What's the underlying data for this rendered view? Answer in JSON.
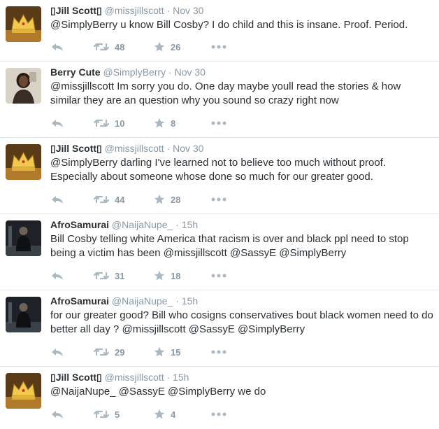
{
  "colors": {
    "name": "#292f33",
    "meta": "#8899a6",
    "action_icon": "#aab8c2",
    "divider": "#e1e8ed"
  },
  "tweets": [
    {
      "fullname": "▯Jill Scott▯",
      "username": "@missjillscott",
      "separator": "·",
      "time": "Nov 30",
      "text": "@SimplyBerry u know Bill Cosby? I do child and this is insane. Proof. Period.",
      "retweets": "48",
      "likes": "26",
      "avatar_icon": "crown-avatar"
    },
    {
      "fullname": "Berry Cute",
      "username": "@SimplyBerry",
      "separator": "·",
      "time": "Nov 30",
      "text": "@missjillscott Im sorry you do. One day maybe youll read the stories & how similar they are an question why you sound so crazy right now",
      "retweets": "10",
      "likes": "8",
      "avatar_icon": "photo-avatar"
    },
    {
      "fullname": "▯Jill Scott▯",
      "username": "@missjillscott",
      "separator": "·",
      "time": "Nov 30",
      "text": "@SimplyBerry darling I've learned not to believe too much without proof. Especially about someone whose done so much for our greater good.",
      "retweets": "44",
      "likes": "28",
      "avatar_icon": "crown-avatar"
    },
    {
      "fullname": "AfroSamurai",
      "username": "@NaijaNupe_",
      "separator": "·",
      "time": "15h",
      "text": "Bill Cosby telling white America that racism is over and black ppl need to stop being a victim has been @missjillscott @SassyE @SimplyBerry",
      "retweets": "31",
      "likes": "18",
      "avatar_icon": "dark-figure-avatar"
    },
    {
      "fullname": "AfroSamurai",
      "username": "@NaijaNupe_",
      "separator": "·",
      "time": "15h",
      "text": "for our greater good? Bill who cosigns conservatives bout black women need to do better all day ?  @missjillscott @SassyE @SimplyBerry",
      "retweets": "29",
      "likes": "15",
      "avatar_icon": "dark-figure-avatar"
    },
    {
      "fullname": "▯Jill Scott▯",
      "username": "@missjillscott",
      "separator": "·",
      "time": "15h",
      "text": "@NaijaNupe_ @SassyE @SimplyBerry we do",
      "retweets": "5",
      "likes": "4",
      "avatar_icon": "crown-avatar"
    }
  ]
}
